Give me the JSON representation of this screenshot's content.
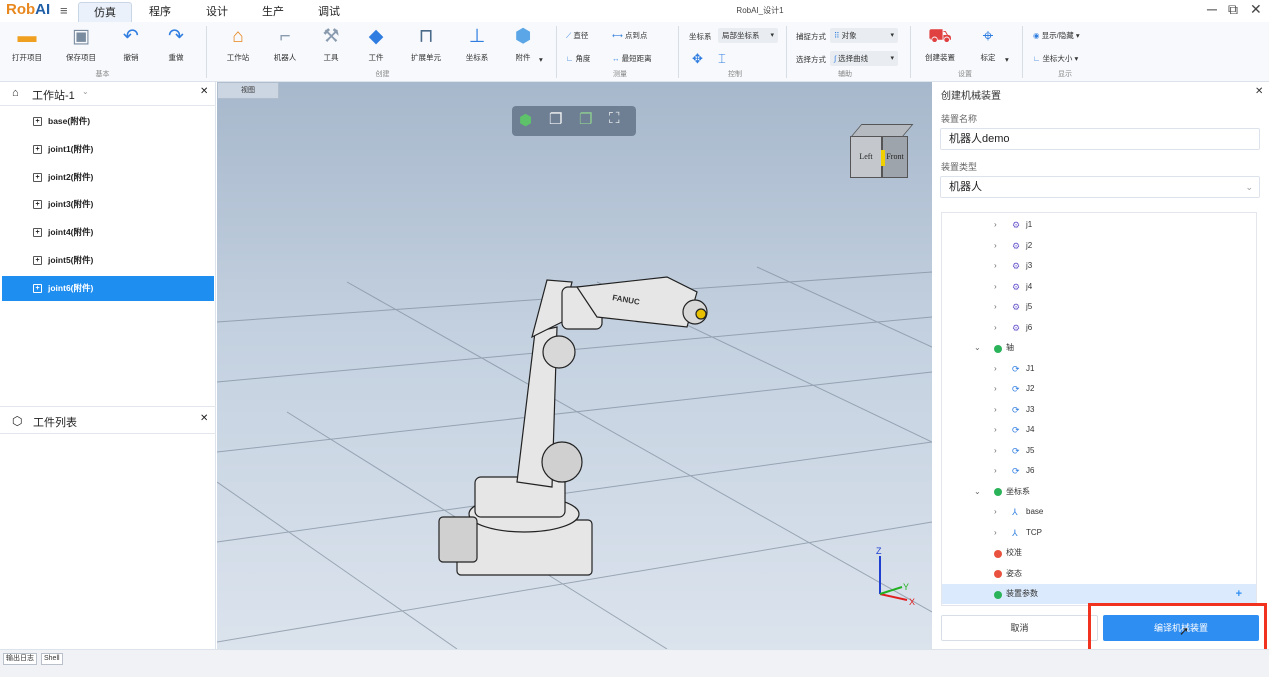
{
  "app": {
    "logo_prefix": "Rob",
    "logo_suffix": "AI",
    "window_title": "RobAI_设计1"
  },
  "menu_tabs": [
    "仿真",
    "程序",
    "设计",
    "生产",
    "调试"
  ],
  "ribbon": {
    "basic": {
      "open": "打开项目",
      "save": "保存项目",
      "undo": "撤销",
      "redo": "重做",
      "group": "基本"
    },
    "create": {
      "workstation": "工作站",
      "robot": "机器人",
      "tool": "工具",
      "workpiece": "工件",
      "ext_unit": "扩展单元",
      "frame": "坐标系",
      "attachment": "附件",
      "group": "创建"
    },
    "measure": {
      "diameter": "直径",
      "point_to_point": "点到点",
      "angle": "角度",
      "min_distance": "最短距离",
      "group": "测量"
    },
    "control": {
      "frame_label": "坐标系",
      "frame_value": "局部坐标系",
      "group": "控制"
    },
    "assist": {
      "capture_label": "捕捉方式",
      "capture_value": "对象",
      "select_label": "选择方式",
      "select_value": "选择曲线",
      "group": "辅助"
    },
    "settings": {
      "create_device": "创建装置",
      "calibrate": "标定",
      "group": "设置"
    },
    "display": {
      "show_hide": "显示/隐藏",
      "frame_size": "坐标大小",
      "group": "显示"
    }
  },
  "left_panel": {
    "workstation_title": "工作站-1",
    "tree_items": [
      "base(附件)",
      "joint1(附件)",
      "joint2(附件)",
      "joint3(附件)",
      "joint4(附件)",
      "joint5(附件)",
      "joint6(附件)"
    ],
    "selected_index": 6,
    "workpiece_title": "工件列表"
  },
  "viewport": {
    "tab": "视图",
    "cube_left": "Left",
    "cube_front": "Front",
    "axis_x": "X",
    "axis_y": "Y",
    "axis_z": "Z",
    "robot_brand": "FANUC"
  },
  "right_panel": {
    "title": "创建机械装置",
    "name_label": "装置名称",
    "name_value": "机器人demo",
    "type_label": "装置类型",
    "type_value": "机器人",
    "tree": [
      {
        "indent": 2,
        "arrow": "›",
        "icon": "link-gear",
        "text": "j1"
      },
      {
        "indent": 2,
        "arrow": "›",
        "icon": "link-gear",
        "text": "j2"
      },
      {
        "indent": 2,
        "arrow": "›",
        "icon": "link-gear",
        "text": "j3"
      },
      {
        "indent": 2,
        "arrow": "›",
        "icon": "link-gear",
        "text": "j4"
      },
      {
        "indent": 2,
        "arrow": "›",
        "icon": "link-gear",
        "text": "j5"
      },
      {
        "indent": 2,
        "arrow": "›",
        "icon": "link-gear",
        "text": "j6"
      },
      {
        "indent": 1,
        "arrow": "⌄",
        "icon": "ok",
        "text": "轴"
      },
      {
        "indent": 2,
        "arrow": "›",
        "icon": "axis",
        "text": "J1"
      },
      {
        "indent": 2,
        "arrow": "›",
        "icon": "axis",
        "text": "J2"
      },
      {
        "indent": 2,
        "arrow": "›",
        "icon": "axis",
        "text": "J3"
      },
      {
        "indent": 2,
        "arrow": "›",
        "icon": "axis",
        "text": "J4"
      },
      {
        "indent": 2,
        "arrow": "›",
        "icon": "axis",
        "text": "J5"
      },
      {
        "indent": 2,
        "arrow": "›",
        "icon": "axis",
        "text": "J6"
      },
      {
        "indent": 1,
        "arrow": "⌄",
        "icon": "ok",
        "text": "坐标系"
      },
      {
        "indent": 2,
        "arrow": "›",
        "icon": "frame",
        "text": "base"
      },
      {
        "indent": 2,
        "arrow": "›",
        "icon": "frame",
        "text": "TCP"
      },
      {
        "indent": 1,
        "arrow": "",
        "icon": "error",
        "text": "校准"
      },
      {
        "indent": 1,
        "arrow": "",
        "icon": "error",
        "text": "姿态"
      },
      {
        "indent": 1,
        "arrow": "",
        "icon": "ok",
        "text": "装置参数",
        "selected": true,
        "plus": "+"
      }
    ],
    "cancel": "取消",
    "compile": "编译机械装置"
  },
  "statusbar": {
    "output_log": "输出日志",
    "shell": "Shell"
  },
  "colors": {
    "accent": "#2f8ef2",
    "ok": "#2bb35a",
    "error": "#e8523e",
    "highlight": "#f0321e"
  }
}
